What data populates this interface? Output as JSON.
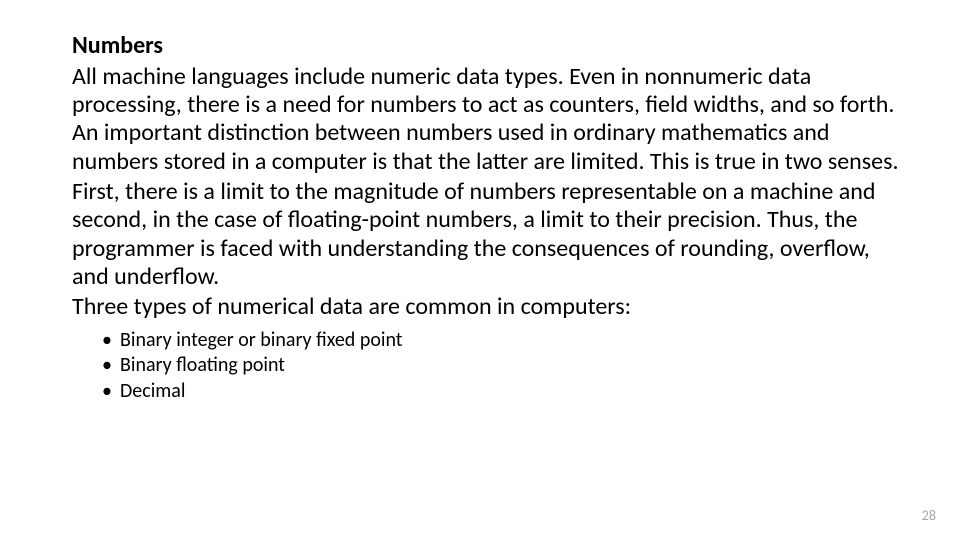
{
  "heading": "Numbers",
  "para1": "All machine languages include numeric data types. Even in nonnumeric data processing, there is a need for numbers to act as counters, field widths, and so forth. An important distinction between numbers used in ordinary mathematics and numbers stored in a computer is that the latter are limited. This is true in two senses.",
  "para2": "First, there is a limit to the magnitude of numbers representable on a machine and second, in the case of floating-point numbers, a limit to their precision. Thus, the programmer is faced with understanding the consequences of rounding, overflow, and underflow.",
  "para3": "Three types of numerical data are common in computers:",
  "bullets": [
    "Binary integer or binary fixed point",
    "Binary floating point",
    "Decimal"
  ],
  "page_number": "28"
}
